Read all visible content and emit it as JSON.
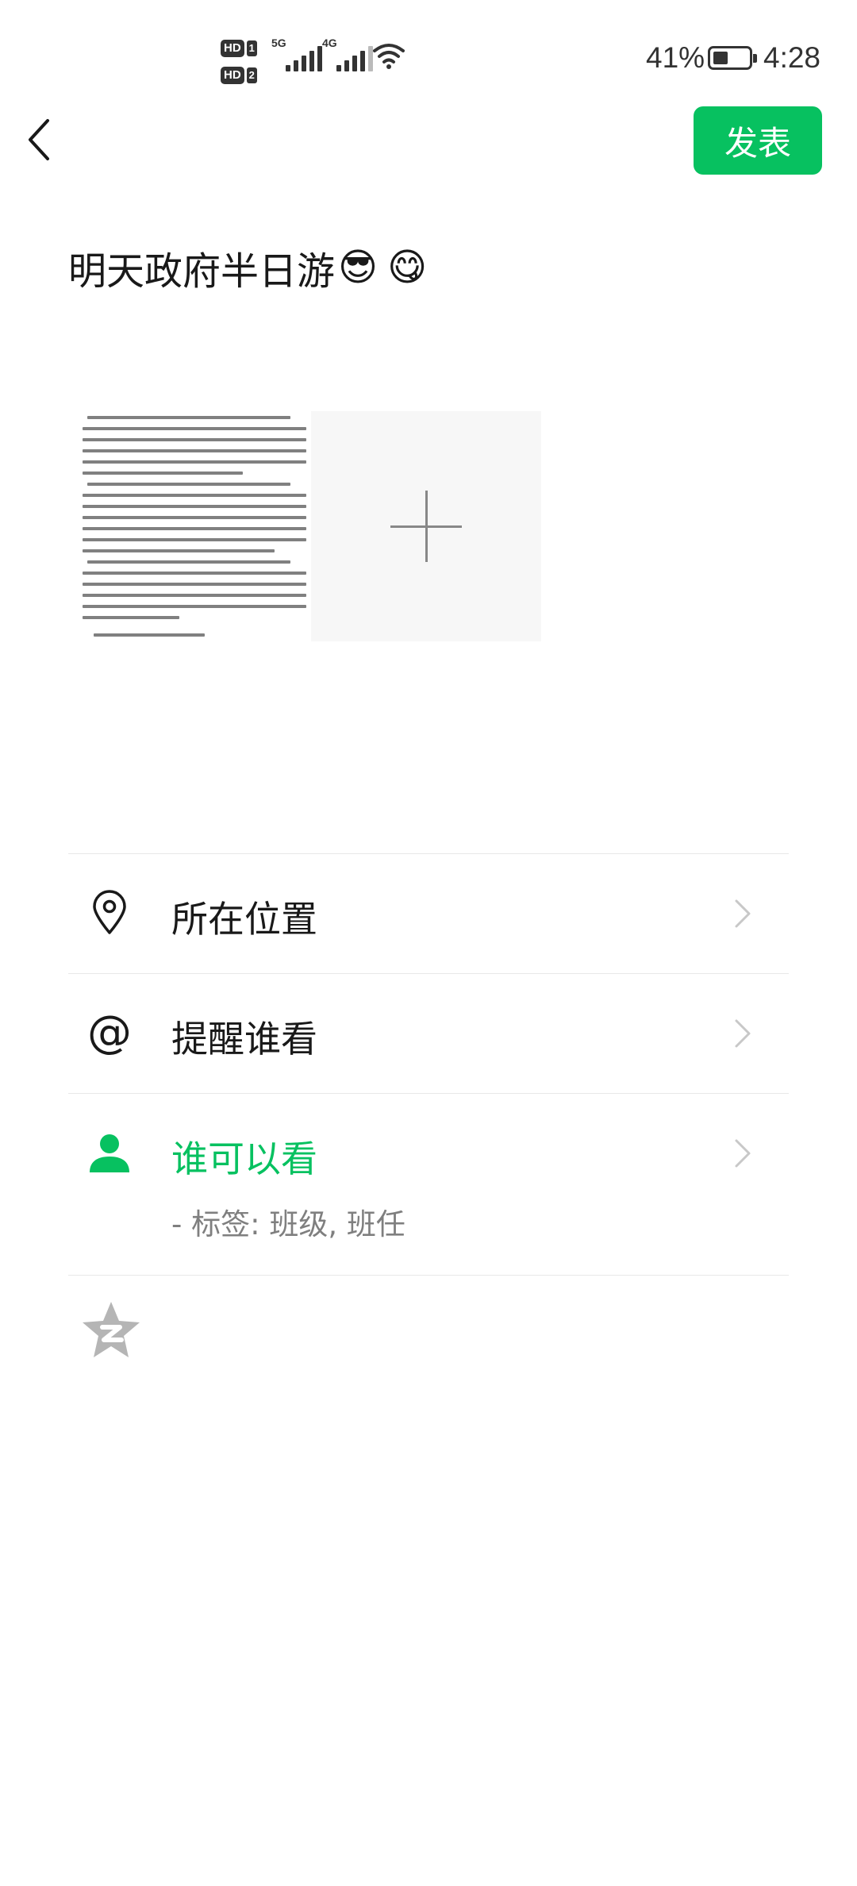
{
  "status_bar": {
    "hd1": "HD",
    "sim1": "1",
    "hd2": "HD",
    "sim2": "2",
    "net1": "5G",
    "net2": "4G",
    "battery_percent": "41%",
    "battery_level": 0.41,
    "time": "4:28"
  },
  "header": {
    "back_icon": "chevron-left-icon",
    "publish_label": "发表",
    "accent_color": "#07c160"
  },
  "post": {
    "text": "明天政府半日游",
    "emojis": [
      "😎",
      "😋"
    ]
  },
  "attachments": {
    "image_count": 1,
    "add_icon": "plus-icon"
  },
  "options": {
    "location": {
      "label": "所在位置",
      "icon": "location-pin-icon"
    },
    "mention": {
      "label": "提醒谁看",
      "icon": "at-icon"
    },
    "visibility": {
      "label": "谁可以看",
      "sub": "- 标签: 班级, 班任",
      "icon": "person-icon",
      "color": "#07c160"
    },
    "qzone_icon": "qzone-star-icon"
  }
}
